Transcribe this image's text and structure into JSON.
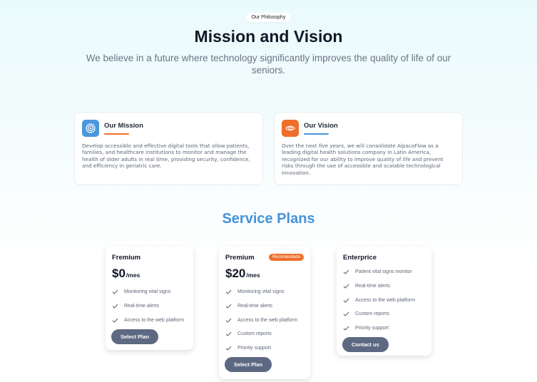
{
  "header": {
    "badge": "Our Philosophy",
    "title": "Mission and Vision",
    "subtitle": "We believe in a future where technology significantly improves the quality of life of our seniors."
  },
  "mission": {
    "icon": "target-icon",
    "title": "Our Mission",
    "body": "Develop accessible and effective digital tools that allow patients, families, and healthcare institutions to monitor and manage the health of older adults in real time, providing security, confidence, and efficiency in geriatric care."
  },
  "vision": {
    "icon": "eye-icon",
    "title": "Our Vision",
    "body": "Over the next five years, we will consolidate AlpacaFlow as a leading digital health solutions company in Latin America, recognized for our ability to improve quality of life and prevent risks through the use of accessible and scalable technological innovation."
  },
  "plans_title": "Service Plans",
  "plans": [
    {
      "name": "Fremium",
      "price": "$0",
      "unit": "/mes",
      "features": [
        "Monitoring vital signs",
        "Real-time alerts",
        "Access to the web platform"
      ],
      "button": "Select Plan"
    },
    {
      "name": "Premium",
      "badge": "Recomendado",
      "price": "$20",
      "unit": "/mes",
      "features": [
        "Monitoring vital signs",
        "Real-time alerts",
        "Access to the web platform",
        "Custom reports",
        "Priority support"
      ],
      "button": "Select Plan"
    },
    {
      "name": "Enterprice",
      "features": [
        "Patient vital signs monitor",
        "Real-time alerts",
        "Access to the web platform",
        "Custom reports",
        "Priority support"
      ],
      "button": "Contact us"
    }
  ],
  "colors": {
    "accent_blue": "#4393dc",
    "accent_orange": "#ef6f2a",
    "button": "#5d6882"
  }
}
